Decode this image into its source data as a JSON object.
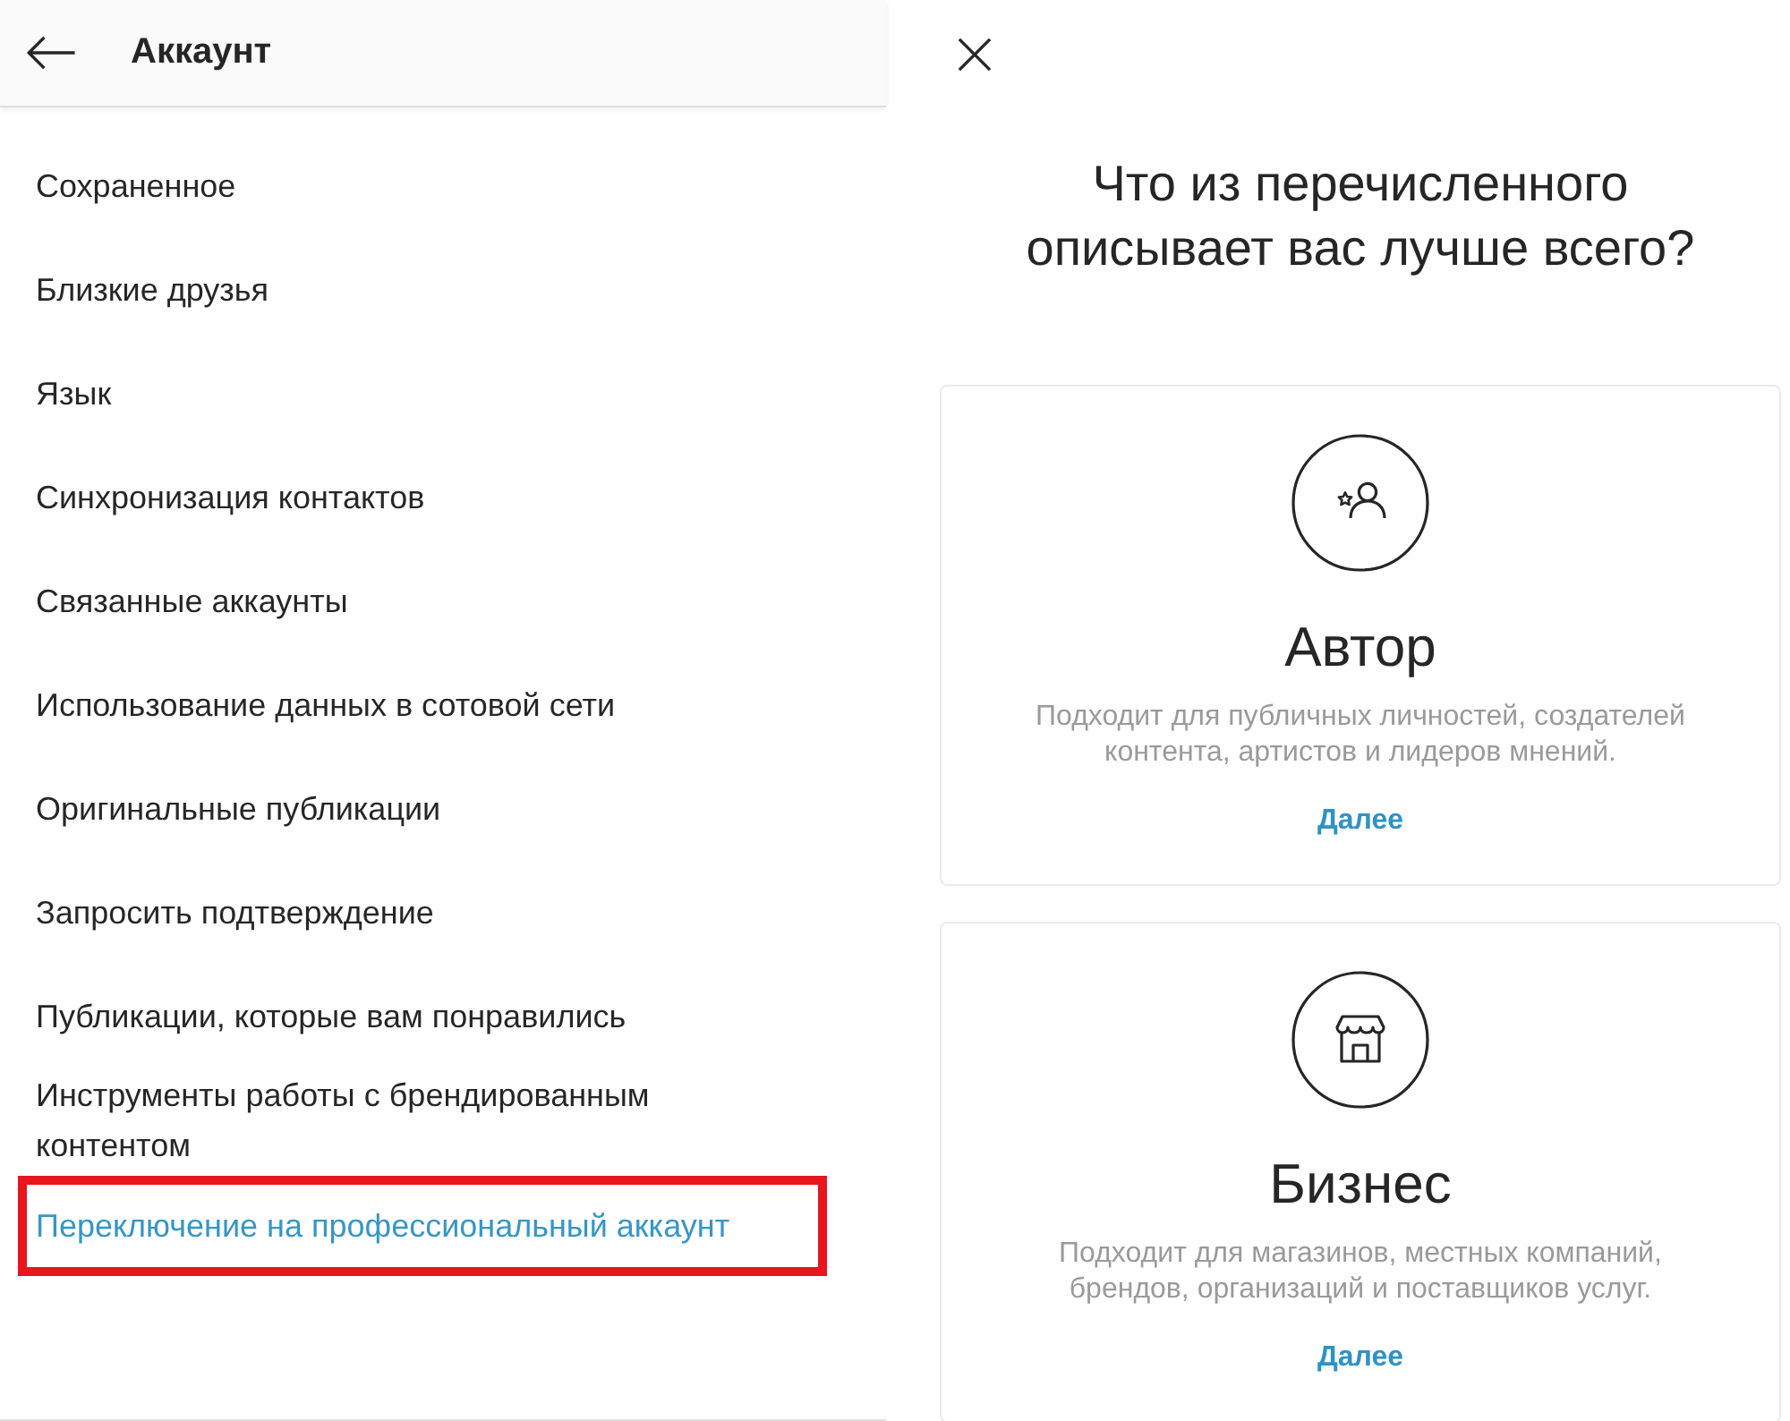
{
  "left_screen": {
    "header": {
      "title": "Аккаунт"
    },
    "items": [
      {
        "label": "Сохраненное",
        "kind": "setting",
        "highlighted": false
      },
      {
        "label": "Близкие друзья",
        "kind": "setting",
        "highlighted": false
      },
      {
        "label": "Язык",
        "kind": "setting",
        "highlighted": false
      },
      {
        "label": "Синхронизация контактов",
        "kind": "setting",
        "highlighted": false
      },
      {
        "label": "Связанные аккаунты",
        "kind": "setting",
        "highlighted": false
      },
      {
        "label": "Использование данных в сотовой сети",
        "kind": "setting",
        "highlighted": false
      },
      {
        "label": "Оригинальные публикации",
        "kind": "setting",
        "highlighted": false
      },
      {
        "label": "Запросить подтверждение",
        "kind": "setting",
        "highlighted": false
      },
      {
        "label": "Публикации, которые вам понравились",
        "kind": "setting",
        "highlighted": false
      },
      {
        "label": "Инструменты работы с брендированным контентом",
        "kind": "setting",
        "highlighted": false
      },
      {
        "label": "Переключение на профессиональный аккаунт",
        "kind": "link",
        "highlighted": true
      }
    ]
  },
  "right_screen": {
    "title": "Что из перечисленного описывает вас лучше всего?",
    "options": [
      {
        "kind": "creator",
        "title": "Автор",
        "description": "Подходит для публичных личностей, создателей контента, артистов и лидеров мнений.",
        "action": "Далее"
      },
      {
        "kind": "business",
        "title": "Бизнес",
        "description": "Подходит для магазинов, местных компаний, брендов, организаций и поставщиков услуг.",
        "action": "Далее"
      }
    ]
  }
}
